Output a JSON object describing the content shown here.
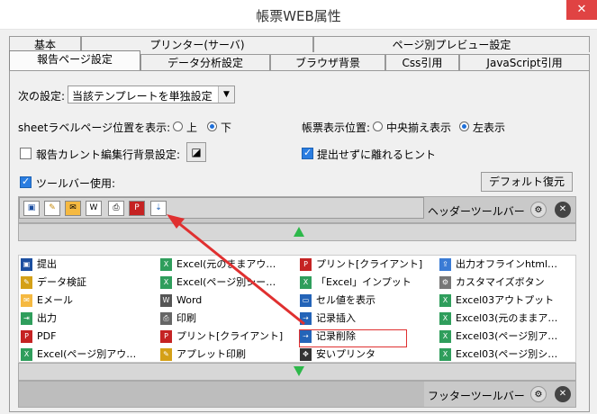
{
  "window": {
    "title": "帳票WEB属性",
    "close": "✕"
  },
  "tabs_row1": [
    "基本",
    "プリンター(サーバ)",
    "ページ別プレビュー設定"
  ],
  "tabs_row2": [
    "報告ページ設定",
    "データ分析設定",
    "ブラウザ背景",
    "Css引用",
    "JavaScript引用"
  ],
  "settings": {
    "next_label": "次の設定:",
    "next_value": "当該テンプレートを単独設定",
    "sheet_label": "sheetラベルページ位置を表示:",
    "sheet_opt_top": "上",
    "sheet_opt_bottom": "下",
    "report_pos_label": "帳票表示位置:",
    "report_pos_center": "中央揃え表示",
    "report_pos_left": "左表示",
    "current_row_label": "報告カレント編集行背景設定:",
    "hint_label": "提出せずに離れるヒント",
    "toolbar_label": "ツールバー使用:",
    "default_button": "デフォルト復元"
  },
  "header_bar": {
    "label": "ヘッダーツールバー"
  },
  "footer_bar": {
    "label": "フッターツールバー"
  },
  "grid": {
    "rows": [
      [
        "提出",
        "Excel(元のままアウ…",
        "プリント[クライアント]",
        "出力オフラインhtml…"
      ],
      [
        "データ検証",
        "Excel(ページ別シー…",
        "「Excel」インプット",
        "カスタマイズボタン"
      ],
      [
        "Eメール",
        "Word",
        "セル値を表示",
        "Excel03アウトプット"
      ],
      [
        "出力",
        "印刷",
        "记录插入",
        "Excel03(元のままア…"
      ],
      [
        "PDF",
        "プリント[クライアント]",
        "记录削除",
        "Excel03(ページ別ア…"
      ],
      [
        "Excel(ページ別アウ…",
        "アプレット印刷",
        "安いプリンタ",
        "Excel03(ページ別シ…"
      ]
    ]
  },
  "colors": {
    "accent": "#2a7de1",
    "close": "#e04343",
    "arrow": "#e03030",
    "green": "#2db84a"
  }
}
